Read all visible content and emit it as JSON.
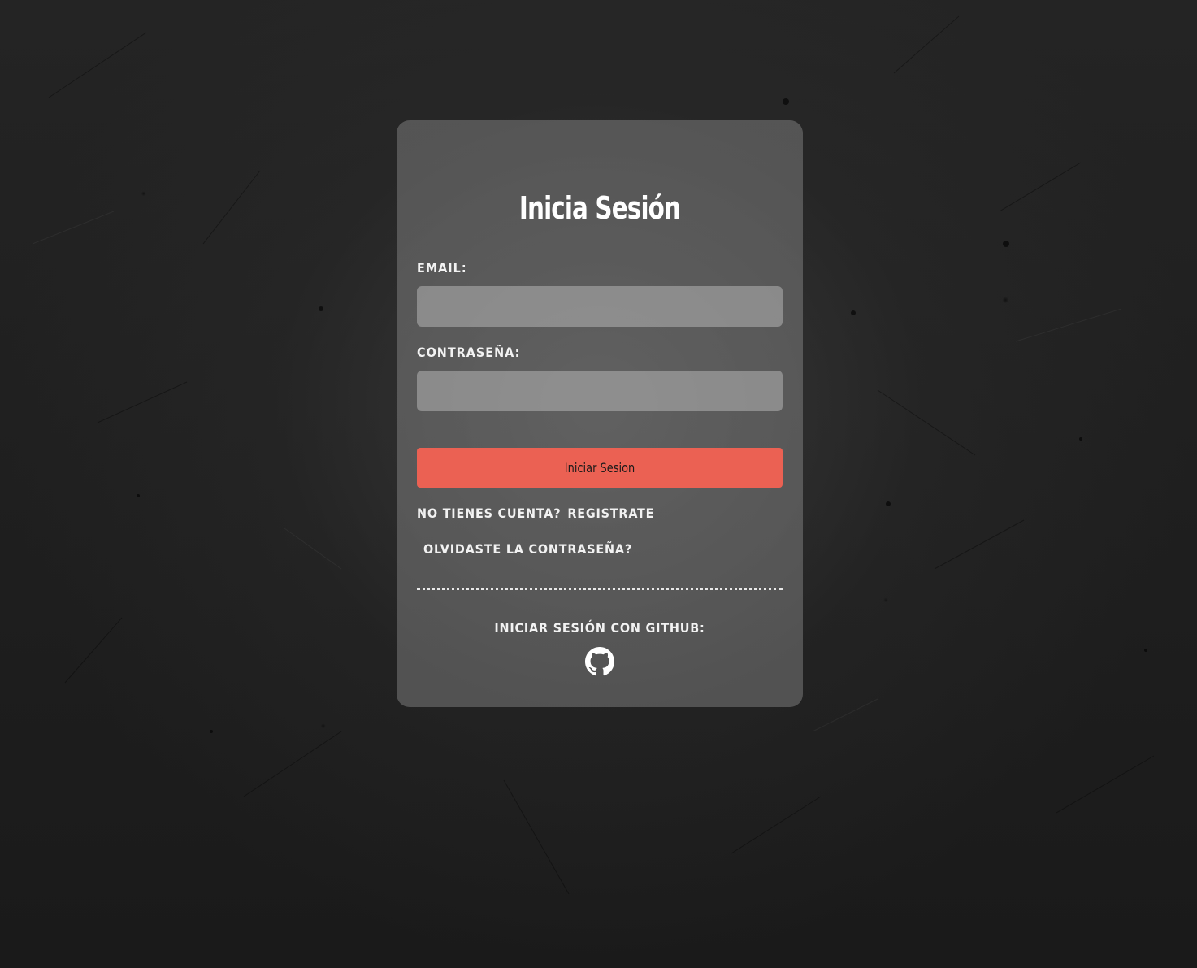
{
  "login": {
    "title": "Inicia Sesión",
    "email_label": "EMAIL:",
    "email_value": "",
    "password_label": "CONTRASEÑA:",
    "password_value": "",
    "submit_label": "Iniciar Sesion",
    "no_account_text": "NO TIENES CUENTA?",
    "register_link": "REGISTRATE",
    "forgot_link": "OLVIDASTE LA CONTRASEÑA?",
    "github_label": "INICIAR SESIÓN CON GITHUB:",
    "github_icon": "github-icon"
  },
  "colors": {
    "accent": "#eb6153",
    "text": "#f2f2f2",
    "background": "#1f1f1f"
  }
}
